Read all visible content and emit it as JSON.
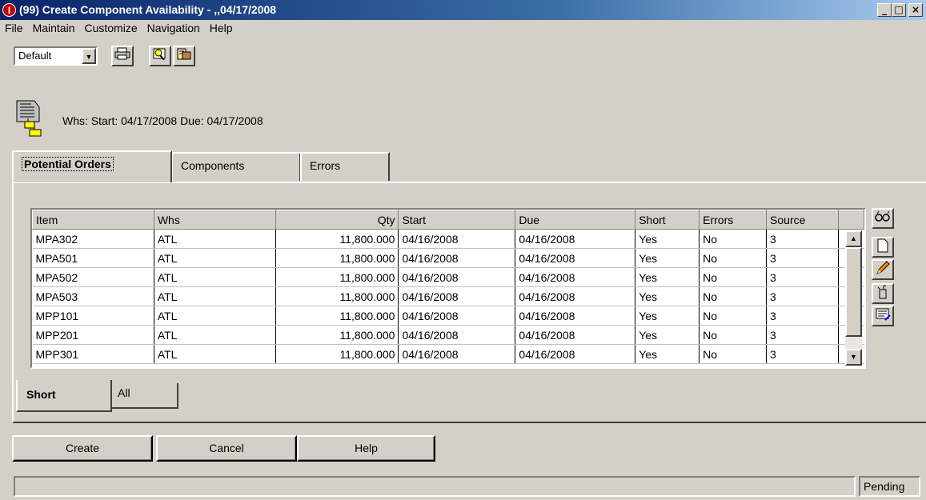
{
  "window": {
    "title": "(99) Create Component Availability - ,,04/17/2008",
    "app_icon_glyph": "I",
    "minimize": "_",
    "maximize": "□",
    "close": "×"
  },
  "menu": [
    "File",
    "Maintain",
    "Customize",
    "Navigation",
    "Help"
  ],
  "toolbar": {
    "layout_value": "Default",
    "buttons": [
      "printer-icon",
      "find-icon",
      "export-icon"
    ]
  },
  "header": {
    "info": "Whs:   Start: 04/17/2008  Due: 04/17/2008"
  },
  "tabs": {
    "potential_orders": "Potential Orders",
    "components": "Components",
    "errors": "Errors"
  },
  "grid": {
    "columns": [
      "Item",
      "Whs",
      "Qty",
      "Start",
      "Due",
      "Short",
      "Errors",
      "Source"
    ],
    "rows": [
      [
        "MPA302",
        "ATL",
        "11,800.000",
        "04/16/2008",
        "04/16/2008",
        "Yes",
        "No",
        "3"
      ],
      [
        "MPA501",
        "ATL",
        "11,800.000",
        "04/16/2008",
        "04/16/2008",
        "Yes",
        "No",
        "3"
      ],
      [
        "MPA502",
        "ATL",
        "11,800.000",
        "04/16/2008",
        "04/16/2008",
        "Yes",
        "No",
        "3"
      ],
      [
        "MPA503",
        "ATL",
        "11,800.000",
        "04/16/2008",
        "04/16/2008",
        "Yes",
        "No",
        "3"
      ],
      [
        "MPP101",
        "ATL",
        "11,800.000",
        "04/16/2008",
        "04/16/2008",
        "Yes",
        "No",
        "3"
      ],
      [
        "MPP201",
        "ATL",
        "11,800.000",
        "04/16/2008",
        "04/16/2008",
        "Yes",
        "No",
        "3"
      ],
      [
        "MPP301",
        "ATL",
        "11,800.000",
        "04/16/2008",
        "04/16/2008",
        "Yes",
        "No",
        "3"
      ]
    ]
  },
  "side_buttons": [
    "view-icon",
    "new-icon",
    "edit-icon",
    "delete-icon",
    "notes-icon"
  ],
  "subtabs": {
    "short": "Short",
    "all": "All"
  },
  "actions": {
    "create": "Create",
    "cancel": "Cancel",
    "help": "Help"
  },
  "status": {
    "message": "",
    "state": "Pending"
  }
}
